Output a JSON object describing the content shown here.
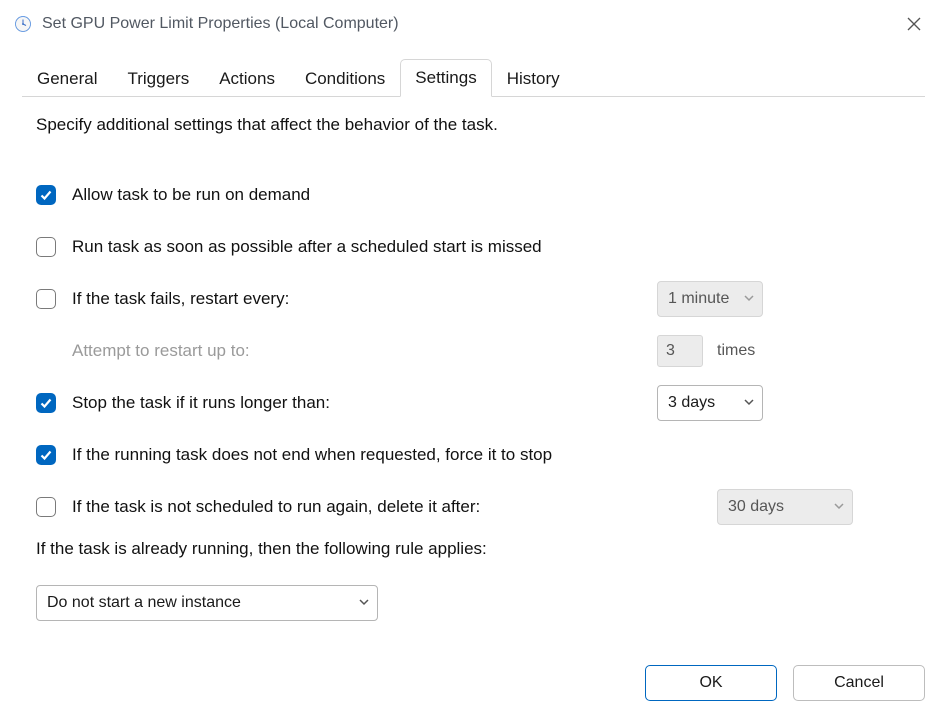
{
  "window": {
    "title": "Set GPU Power Limit Properties (Local Computer)"
  },
  "tabs": {
    "general": "General",
    "triggers": "Triggers",
    "actions": "Actions",
    "conditions": "Conditions",
    "settings": "Settings",
    "history": "History",
    "selected": "Settings"
  },
  "settings": {
    "description": "Specify additional settings that affect the behavior of the task.",
    "allow_on_demand": {
      "label": "Allow task to be run on demand",
      "checked": true
    },
    "run_asap": {
      "label": "Run task as soon as possible after a scheduled start is missed",
      "checked": false
    },
    "restart_if_fail": {
      "label": "If the task fails, restart every:",
      "checked": false,
      "interval": "1 minute"
    },
    "attempts": {
      "label": "Attempt to restart up to:",
      "value": "3",
      "suffix": "times"
    },
    "stop_if_longer": {
      "label": "Stop the task if it runs longer than:",
      "checked": true,
      "value": "3 days"
    },
    "force_stop": {
      "label": "If the running task does not end when requested, force it to stop",
      "checked": true
    },
    "delete_if_not_scheduled": {
      "label": "If the task is not scheduled to run again, delete it after:",
      "checked": false,
      "value": "30 days"
    },
    "rule": {
      "label": "If the task is already running, then the following rule applies:",
      "value": "Do not start a new instance"
    }
  },
  "footer": {
    "ok": "OK",
    "cancel": "Cancel"
  }
}
